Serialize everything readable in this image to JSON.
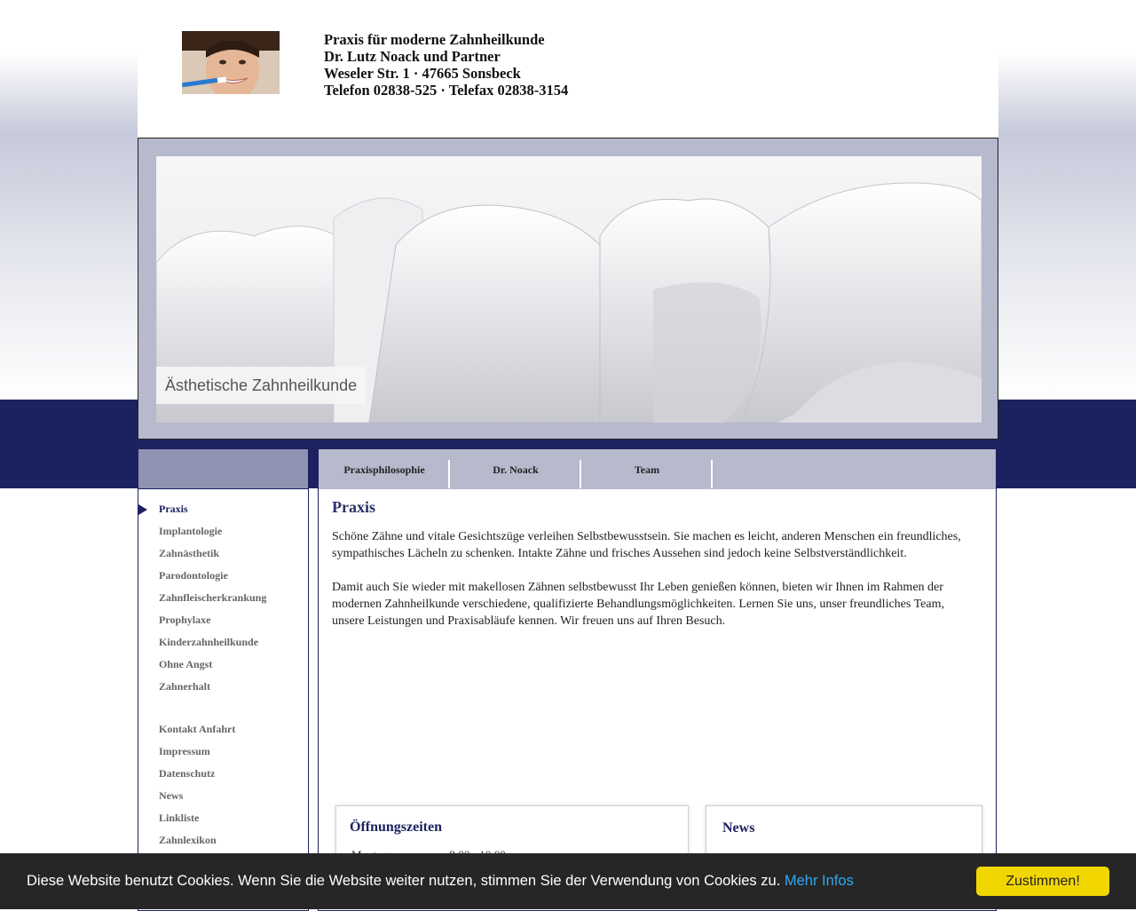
{
  "header": {
    "lines": [
      "Praxis für moderne Zahnheilkunde",
      "Dr. Lutz Noack und Partner",
      "Weseler Str. 1 · 47665 Sonsbeck",
      "Telefon 02838-525 · Telefax 02838-3154"
    ]
  },
  "hero": {
    "caption": "Ästhetische Zahnheilkunde"
  },
  "tabs": [
    "Praxisphilosophie",
    "Dr. Noack",
    "Team"
  ],
  "sidebar": {
    "items": [
      {
        "label": "Praxis",
        "active": true
      },
      {
        "label": "Implantologie"
      },
      {
        "label": "Zahnästhetik"
      },
      {
        "label": "Parodontologie"
      },
      {
        "label": "Zahnfleischerkrankung"
      },
      {
        "label": "Prophylaxe"
      },
      {
        "label": "Kinderzahnheilkunde"
      },
      {
        "label": "Ohne Angst"
      },
      {
        "label": "Zahnerhalt"
      }
    ],
    "secondary": [
      {
        "label": "Kontakt Anfahrt"
      },
      {
        "label": "Impressum"
      },
      {
        "label": "Datenschutz"
      },
      {
        "label": "News"
      },
      {
        "label": "Linkliste"
      },
      {
        "label": "Zahnlexikon"
      }
    ]
  },
  "main": {
    "title": "Praxis",
    "paragraphs": [
      "Schöne Zähne und vitale Gesichtszüge verleihen Selbstbewusstsein. Sie machen es leicht, anderen Menschen ein freundliches, sympathisches Lächeln zu schenken. Intakte Zähne und frisches Aussehen sind jedoch keine Selbstverständlichkeit.",
      "Damit auch Sie wieder mit makellosen Zähnen selbstbewusst Ihr Leben genießen können, bieten wir Ihnen im Rahmen der modernen Zahnheilkunde verschiedene, qualifizierte Behandlungsmöglichkeiten. Lernen Sie uns, unser freundliches Team, unsere Leistungen und Praxisabläufe kennen. Wir freuen uns auf Ihren Besuch."
    ]
  },
  "opening_hours": {
    "title": "Öffnungszeiten",
    "first_row": {
      "day": "Montag",
      "hours": "8:00 - 10:00"
    }
  },
  "news": {
    "title": "News"
  },
  "cookie": {
    "text": "Diese Website benutzt Cookies. Wenn Sie die Website weiter nutzen, stimmen Sie der Verwendung von Cookies zu.",
    "link": "Mehr Infos",
    "button": "Zustimmen!"
  },
  "colors": {
    "navy": "#1c2260",
    "lavender": "#b7b9cd",
    "cookie_button": "#f1d600",
    "link": "#31a8f0"
  }
}
